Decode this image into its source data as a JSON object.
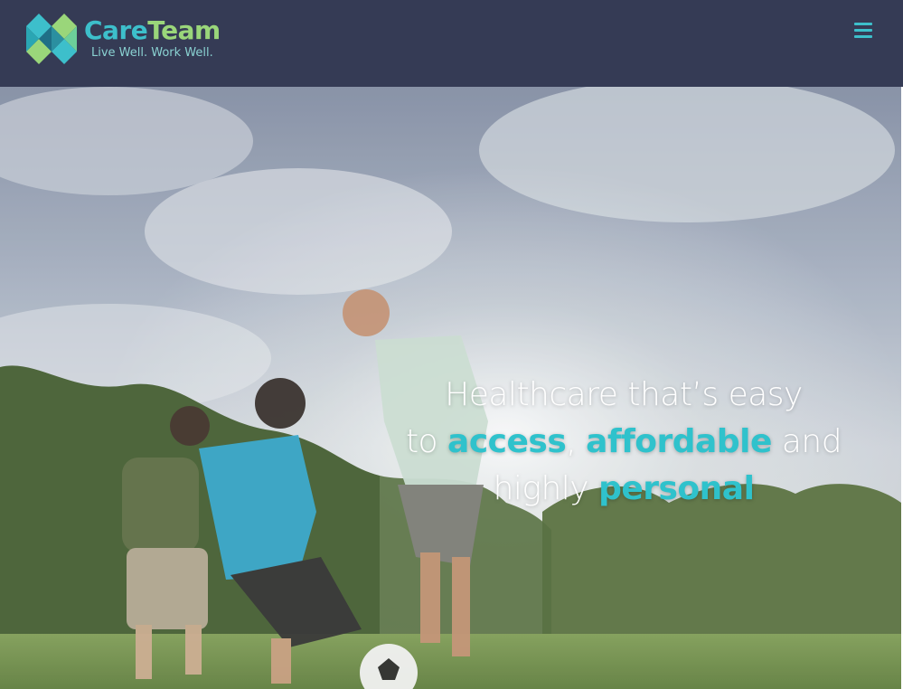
{
  "brand": {
    "name_part1": "Care",
    "name_part2": "Team",
    "tagline": "Live Well. Work Well."
  },
  "header": {
    "menu_icon": "hamburger-menu-icon"
  },
  "hero": {
    "image": "family playing soccer in a park",
    "headline": {
      "line1": "Healthcare that’s easy",
      "line2_pre": "to ",
      "line2_em1": "access",
      "line2_mid": ", ",
      "line2_em2": "affordable",
      "line2_post": " and",
      "line3_pre": "highly ",
      "line3_em": "personal"
    }
  },
  "colors": {
    "header_bg": "#353b55",
    "accent_teal": "#2fc2cc",
    "accent_green": "#9ad67a"
  }
}
